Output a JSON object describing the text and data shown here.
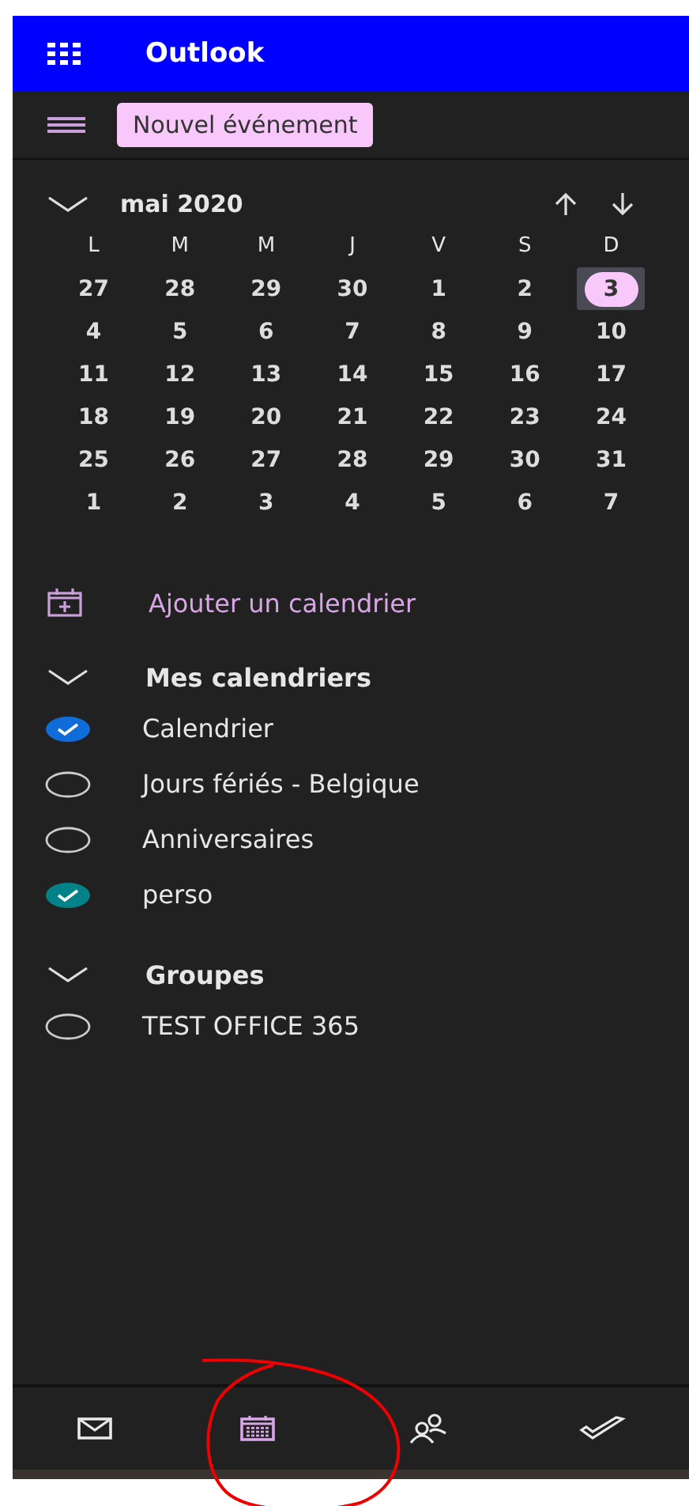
{
  "app": {
    "title": "Outlook"
  },
  "new_event_button": "Nouvel événement",
  "month": {
    "title": "mai 2020",
    "weekdays": [
      "L",
      "M",
      "M",
      "J",
      "V",
      "S",
      "D"
    ],
    "weeks": [
      [
        {
          "label": "27",
          "selected": false
        },
        {
          "label": "28",
          "selected": false
        },
        {
          "label": "29",
          "selected": false
        },
        {
          "label": "30",
          "selected": false
        },
        {
          "label": "1",
          "selected": false
        },
        {
          "label": "2",
          "selected": false
        },
        {
          "label": "3",
          "selected": true
        }
      ],
      [
        {
          "label": "4",
          "selected": false
        },
        {
          "label": "5",
          "selected": false
        },
        {
          "label": "6",
          "selected": false
        },
        {
          "label": "7",
          "selected": false
        },
        {
          "label": "8",
          "selected": false
        },
        {
          "label": "9",
          "selected": false
        },
        {
          "label": "10",
          "selected": false
        }
      ],
      [
        {
          "label": "11",
          "selected": false
        },
        {
          "label": "12",
          "selected": false
        },
        {
          "label": "13",
          "selected": false
        },
        {
          "label": "14",
          "selected": false
        },
        {
          "label": "15",
          "selected": false
        },
        {
          "label": "16",
          "selected": false
        },
        {
          "label": "17",
          "selected": false
        }
      ],
      [
        {
          "label": "18",
          "selected": false
        },
        {
          "label": "19",
          "selected": false
        },
        {
          "label": "20",
          "selected": false
        },
        {
          "label": "21",
          "selected": false
        },
        {
          "label": "22",
          "selected": false
        },
        {
          "label": "23",
          "selected": false
        },
        {
          "label": "24",
          "selected": false
        }
      ],
      [
        {
          "label": "25",
          "selected": false
        },
        {
          "label": "26",
          "selected": false
        },
        {
          "label": "27",
          "selected": false
        },
        {
          "label": "28",
          "selected": false
        },
        {
          "label": "29",
          "selected": false
        },
        {
          "label": "30",
          "selected": false
        },
        {
          "label": "31",
          "selected": false
        }
      ],
      [
        {
          "label": "1",
          "selected": false
        },
        {
          "label": "2",
          "selected": false
        },
        {
          "label": "3",
          "selected": false
        },
        {
          "label": "4",
          "selected": false
        },
        {
          "label": "5",
          "selected": false
        },
        {
          "label": "6",
          "selected": false
        },
        {
          "label": "7",
          "selected": false
        }
      ]
    ]
  },
  "add_calendar_link": "Ajouter un calendrier",
  "groups": [
    {
      "title": "Mes calendriers",
      "expanded": true,
      "items": [
        {
          "label": "Calendrier",
          "checked": true,
          "color": "#0f6cd8"
        },
        {
          "label": "Jours fériés - Belgique",
          "checked": false
        },
        {
          "label": "Anniversaires",
          "checked": false
        },
        {
          "label": "perso",
          "checked": true,
          "color": "#038387"
        }
      ]
    },
    {
      "title": "Groupes",
      "expanded": true,
      "items": [
        {
          "label": "TEST OFFICE 365",
          "checked": false
        }
      ]
    }
  ],
  "bottom_nav": [
    {
      "kind": "mail",
      "selected": false
    },
    {
      "kind": "calendar",
      "selected": true
    },
    {
      "kind": "people",
      "selected": false
    },
    {
      "kind": "tasks",
      "selected": false
    }
  ]
}
